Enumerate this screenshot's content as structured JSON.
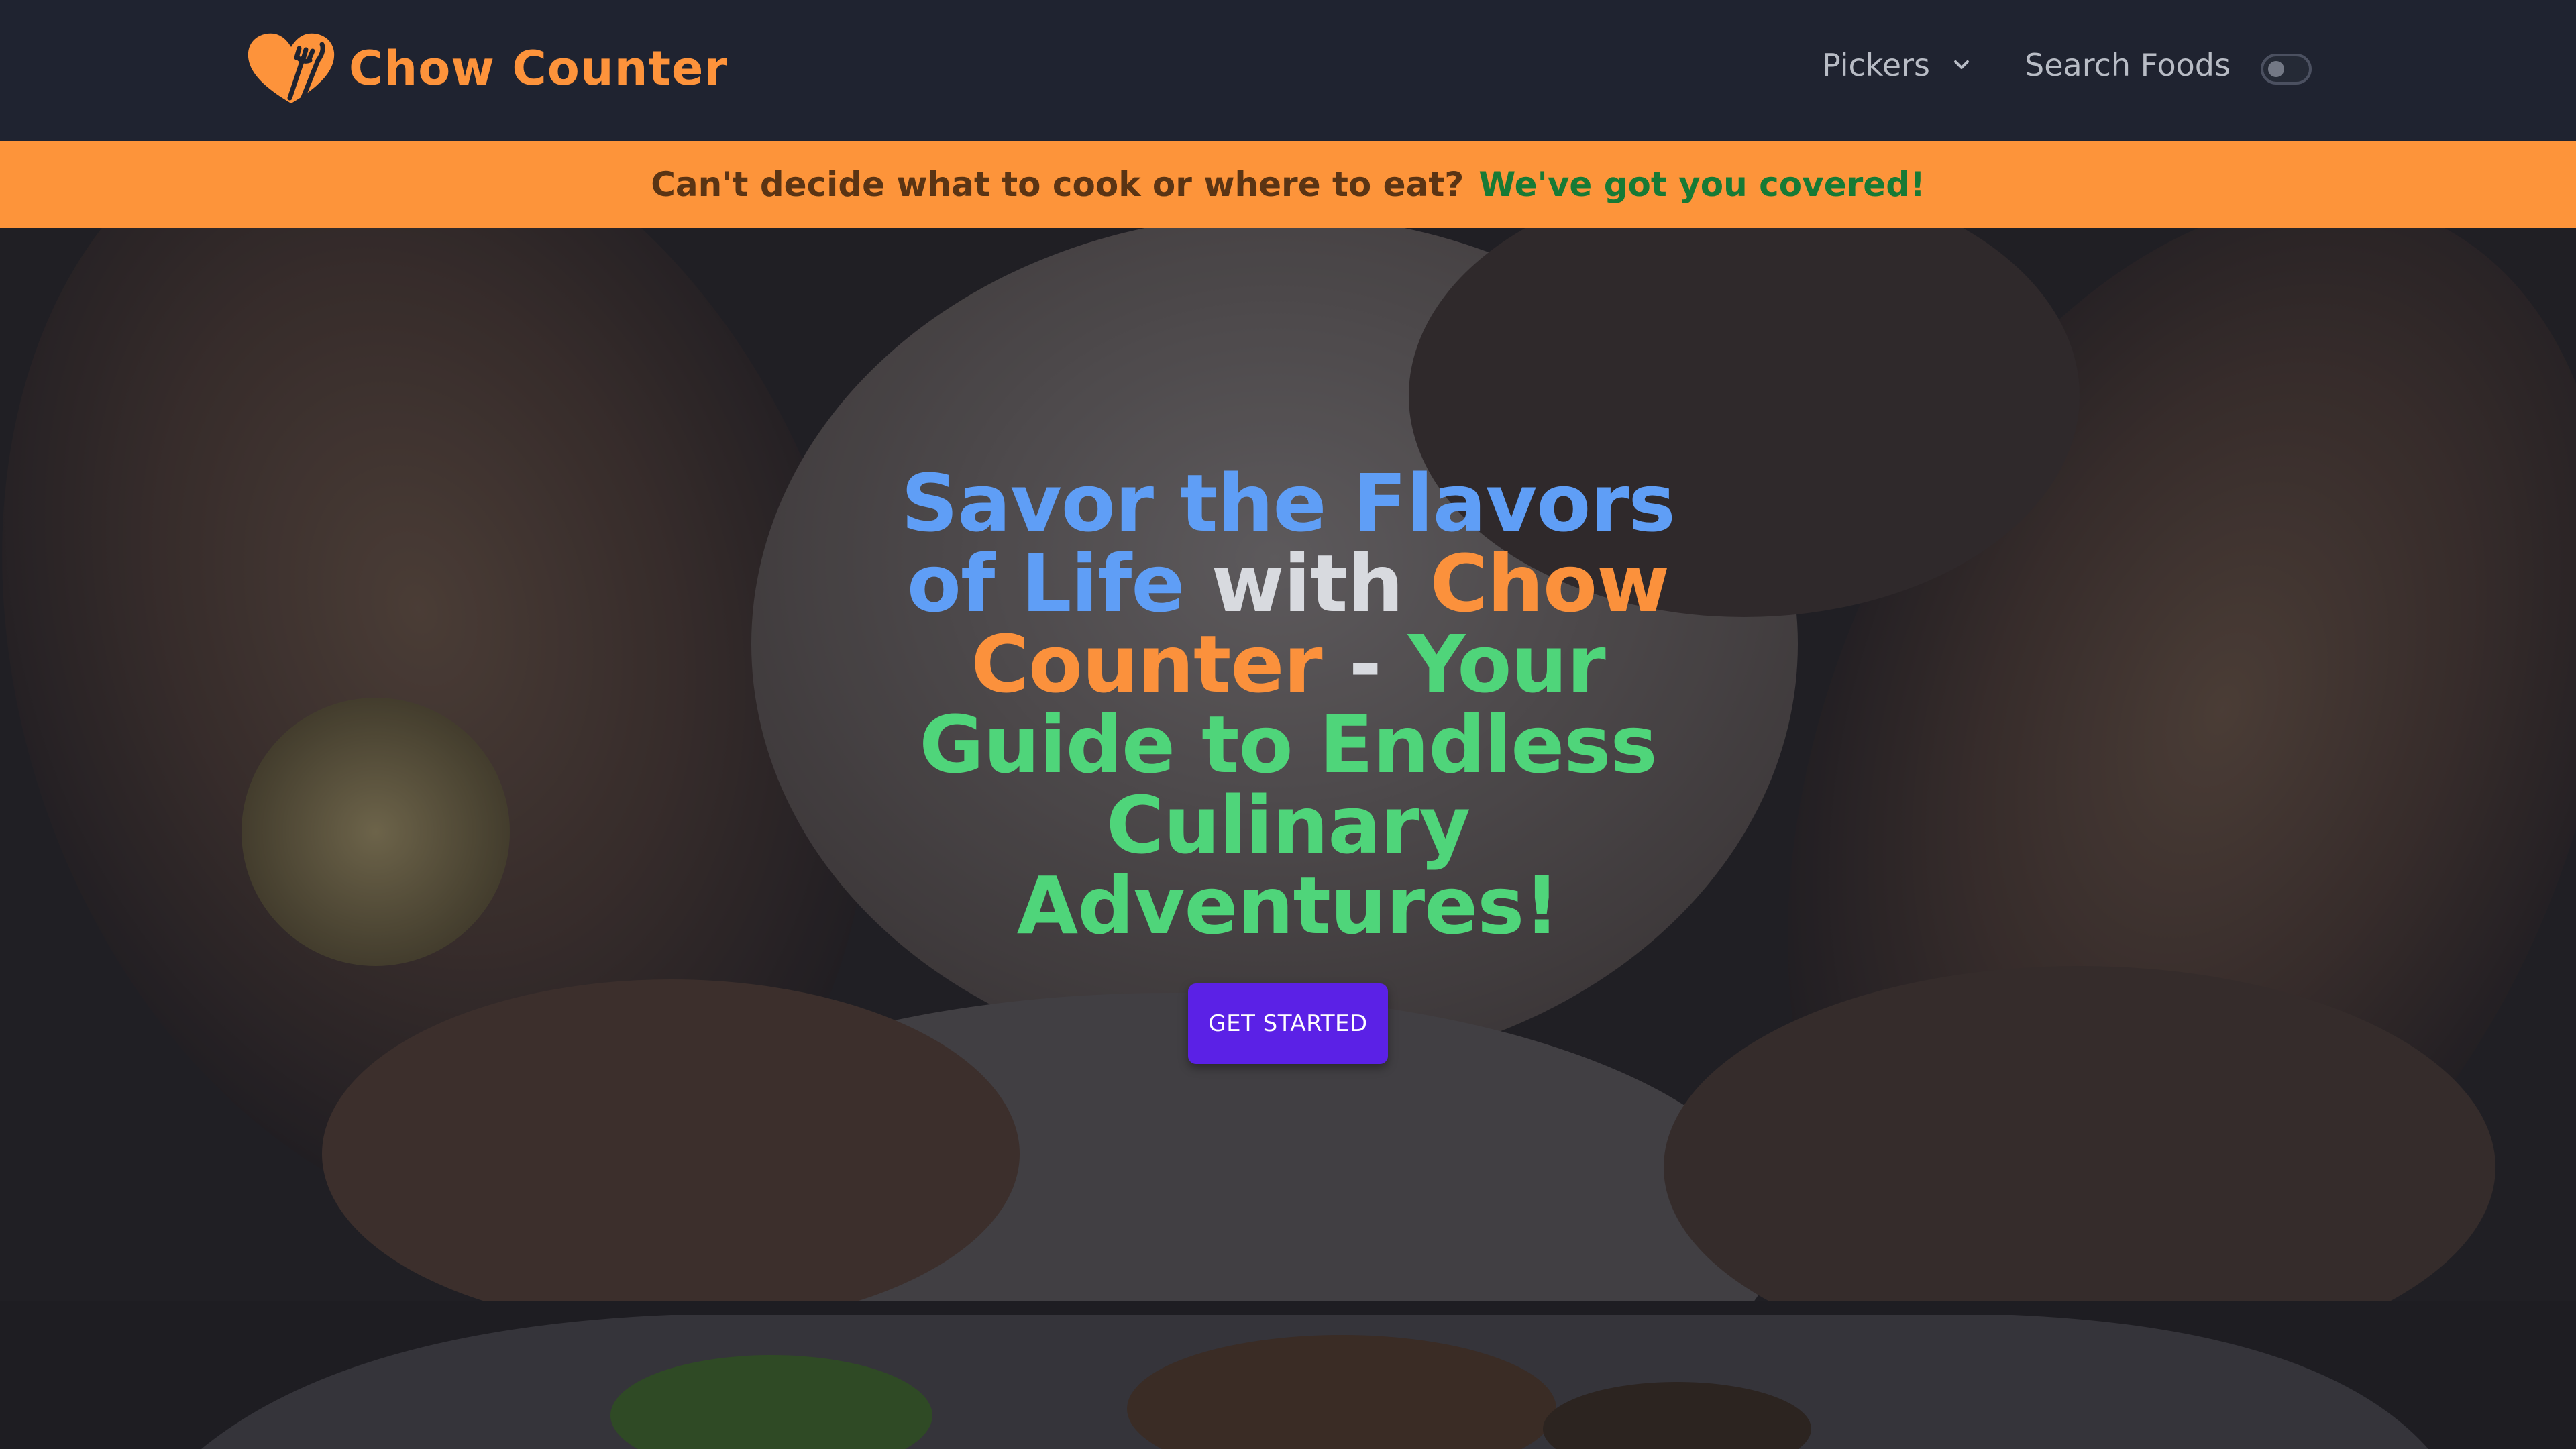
{
  "brand": {
    "name": "Chow Counter",
    "icon": "heart-fork-knife-logo-icon"
  },
  "nav": {
    "pickers_label": "Pickers",
    "pickers_icon": "chevron-down-icon",
    "search_label": "Search Foods",
    "theme_toggle_icon": "toggle-switch-icon"
  },
  "banner": {
    "question": "Can't decide what to cook or where to eat?",
    "answer": "We've got you covered!"
  },
  "hero": {
    "title_parts": {
      "p1": "Savor the Flavors of Life",
      "p2": "with",
      "p3": "Chow Counter",
      "p4": "-",
      "p5": "Your Guide to Endless Culinary Adventures!"
    },
    "cta_label": "GET STARTED",
    "background": "pastry-cannoli-photo"
  },
  "colors": {
    "brand_orange": "#fd933b",
    "banner_bg": "#fd943a",
    "banner_green": "#177a35",
    "title_blue": "#5f9ef6",
    "title_green": "#4fd57a",
    "cta_purple": "#5b21e6",
    "navbar_bg": "#1f2330"
  }
}
